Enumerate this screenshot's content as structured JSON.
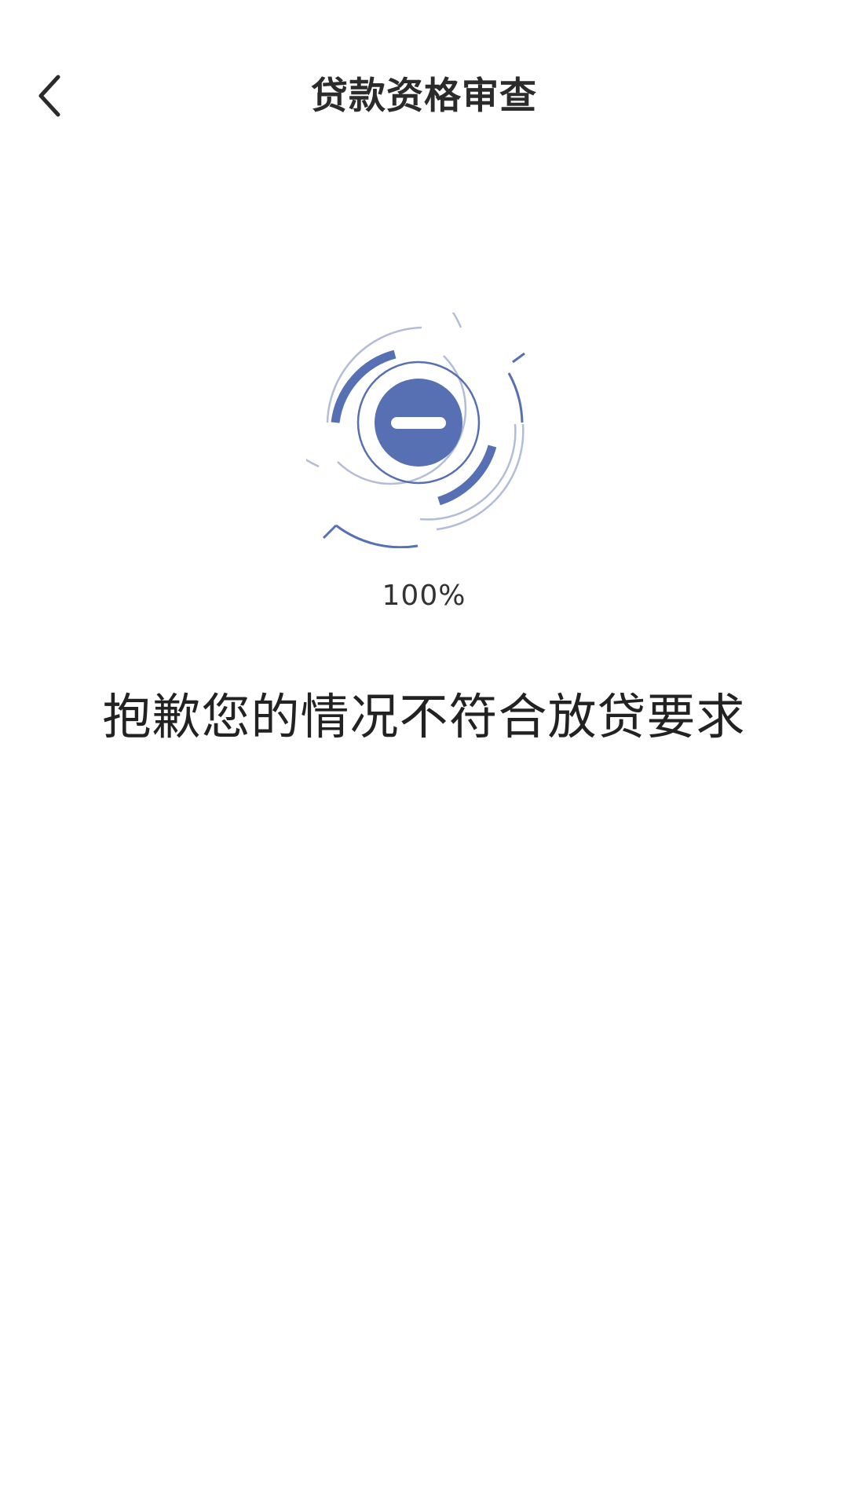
{
  "header": {
    "title": "贷款资格审查",
    "back_icon": "chevron-left-icon"
  },
  "status": {
    "icon": "minus-circle-icon",
    "progress_text": "100%",
    "progress": 100,
    "message": "抱歉您的情况不符合放贷要求"
  },
  "colors": {
    "accent": "#5670b3",
    "accent_light": "#b3bcd8",
    "text_primary": "#222222",
    "background": "#ffffff"
  }
}
